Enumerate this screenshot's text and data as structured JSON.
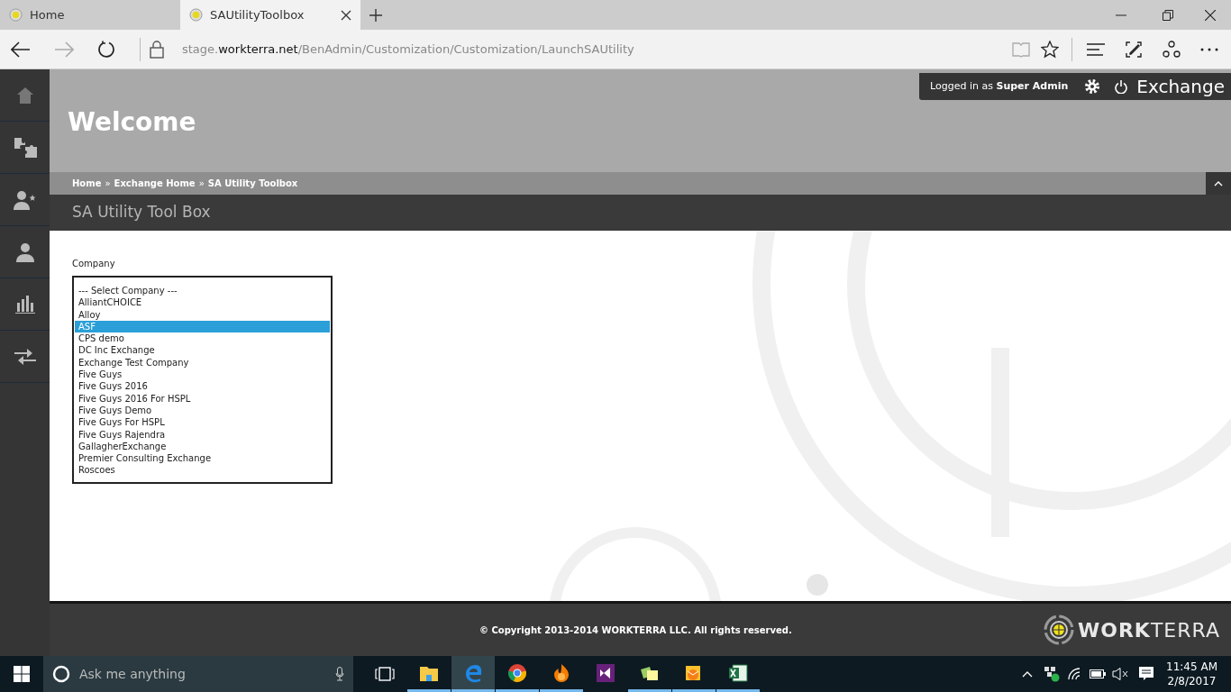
{
  "browser": {
    "tabs": [
      {
        "label": "Home",
        "selected": false
      },
      {
        "label": "SAUtilityToolbox",
        "selected": true
      }
    ],
    "address": {
      "prefix": "stage.",
      "host": "workterra.net",
      "path": "/BenAdmin/Customization/Customization/LaunchSAUtility"
    }
  },
  "header": {
    "welcome": "Welcome",
    "user": "Logged in as **Super Admin**",
    "module": "Exchange"
  },
  "breadcrumb": [
    {
      "kind": "link",
      "text": "Home"
    },
    {
      "kind": "separator",
      "text": "»"
    },
    {
      "kind": "link",
      "text": "Exchange Home"
    },
    {
      "kind": "separator",
      "text": "»"
    },
    {
      "kind": "link",
      "text": "SA Utility Toolbox"
    }
  ],
  "page_title": "SA Utility Tool Box",
  "company": {
    "label": "Company",
    "options": [
      {
        "text": "--- Select Company ---",
        "selected": false
      },
      {
        "text": "AlliantCHOICE",
        "selected": false
      },
      {
        "text": "Alloy",
        "selected": false
      },
      {
        "text": "ASF",
        "selected": true
      },
      {
        "text": "CPS demo",
        "selected": false
      },
      {
        "text": "DC Inc Exchange",
        "selected": false
      },
      {
        "text": "Exchange Test Company",
        "selected": false
      },
      {
        "text": "Five Guys",
        "selected": false
      },
      {
        "text": "Five Guys 2016",
        "selected": false
      },
      {
        "text": "Five Guys 2016 For HSPL",
        "selected": false
      },
      {
        "text": "Five Guys Demo",
        "selected": false
      },
      {
        "text": "Five Guys For HSPL",
        "selected": false
      },
      {
        "text": "Five Guys Rajendra",
        "selected": false
      },
      {
        "text": "GallagherExchange",
        "selected": false
      },
      {
        "text": "Premier Consulting Exchange",
        "selected": false
      },
      {
        "text": "Roscoes",
        "selected": false
      }
    ]
  },
  "footer": {
    "copyright": "© Copyright 2013-2014 WORKTERRA LLC. All rights reserved.",
    "logo": "**WORK**TERRA"
  },
  "taskbar": {
    "search_placeholder": "Ask me anything",
    "apps": [
      {
        "kind": "folder",
        "running": true,
        "selected": false
      },
      {
        "kind": "edge",
        "running": true,
        "selected": true
      },
      {
        "kind": "chrome",
        "running": true,
        "selected": false
      },
      {
        "kind": "flame",
        "running": true,
        "selected": false
      },
      {
        "kind": "studio",
        "running": false,
        "selected": false
      },
      {
        "kind": "notes",
        "running": true,
        "selected": false
      },
      {
        "kind": "mail",
        "running": true,
        "selected": false
      },
      {
        "kind": "sheet",
        "running": true,
        "selected": false
      }
    ],
    "time": "11:45 AM",
    "date": "2/8/2017"
  }
}
